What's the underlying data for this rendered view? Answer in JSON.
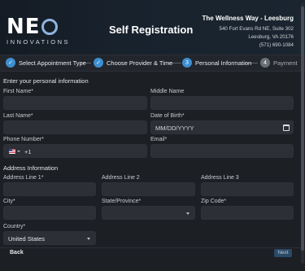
{
  "header": {
    "logo_main": "NE",
    "logo_sub": "INNOVATIONS",
    "page_title": "Self Registration",
    "clinic": {
      "name": "The Wellness Way - Leesburg",
      "address1": "540 Fort Evans Rd NE, Suite 302",
      "address2": "Leesburg, VA 20176",
      "phone": "(571) 690-1084"
    }
  },
  "stepper": {
    "steps": [
      {
        "label": "Select Appointment Type",
        "state": "done",
        "marker": "✓"
      },
      {
        "label": "Choose Provider & Time",
        "state": "done",
        "marker": "✓"
      },
      {
        "label": "Personal Information",
        "state": "active",
        "marker": "3"
      },
      {
        "label": "Payment",
        "state": "todo",
        "marker": "4"
      }
    ]
  },
  "personal": {
    "section_title": "Enter your personal information",
    "first_name_label": "First Name*",
    "middle_name_label": "Middle Name",
    "last_name_label": "Last Name*",
    "dob_label": "Date of Birth*",
    "dob_placeholder": "MM/DD/YYYY",
    "phone_label": "Phone Number*",
    "phone_dial_code": "+1",
    "email_label": "Email*"
  },
  "address": {
    "section_title": "Address Information",
    "line1_label": "Address Line 1*",
    "line2_label": "Address Line 2",
    "line3_label": "Address Line 3",
    "city_label": "City*",
    "state_label": "State/Province*",
    "zip_label": "Zip Code*",
    "country_label": "Country*",
    "country_value": "United States"
  },
  "footer": {
    "back_label": "Back",
    "next_label": "Next"
  },
  "colors": {
    "accent": "#3d8fd1",
    "background": "#1c1f24",
    "input": "#2c3036"
  }
}
